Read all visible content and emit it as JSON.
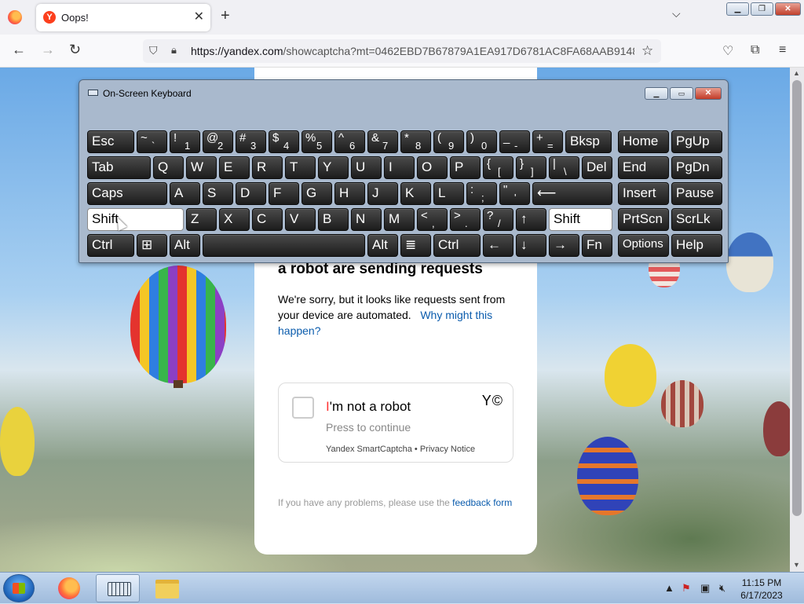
{
  "browser": {
    "tab_title": "Oops!",
    "tab_favicon": "Y",
    "new_tab": "+",
    "url_domain": "https://yandex.com",
    "url_rest": "/showcaptcha?mt=0462EBD7B67879A1EA917D6781AC8FA68AAB9148"
  },
  "page": {
    "heading": "a robot are sending requests",
    "body_text": "We're sorry, but it looks like requests sent from your device are automated.",
    "body_link": "Why might this happen?",
    "captcha": {
      "title_first": "I",
      "title_rest": "'m not a robot",
      "press": "Press to continue",
      "brand": "Y©",
      "footer": "Yandex SmartCaptcha • Privacy Notice"
    },
    "note_text": "If you have any problems, please use the",
    "note_link": "feedback form"
  },
  "osk": {
    "title": "On-Screen Keyboard",
    "rows": [
      [
        {
          "label": "Esc"
        },
        {
          "top": "~",
          "bottom": "`"
        },
        {
          "top": "!",
          "bottom": "1"
        },
        {
          "top": "@",
          "bottom": "2"
        },
        {
          "top": "#",
          "bottom": "3"
        },
        {
          "top": "$",
          "bottom": "4"
        },
        {
          "top": "%",
          "bottom": "5"
        },
        {
          "top": "^",
          "bottom": "6"
        },
        {
          "top": "&",
          "bottom": "7"
        },
        {
          "top": "*",
          "bottom": "8"
        },
        {
          "top": "(",
          "bottom": "9"
        },
        {
          "top": ")",
          "bottom": "0"
        },
        {
          "top": "_",
          "bottom": "-"
        },
        {
          "top": "+",
          "bottom": "="
        },
        {
          "label": "Bksp"
        },
        {
          "label": "Home"
        },
        {
          "label": "PgUp"
        }
      ],
      [
        {
          "label": "Tab"
        },
        {
          "label": "Q"
        },
        {
          "label": "W"
        },
        {
          "label": "E"
        },
        {
          "label": "R"
        },
        {
          "label": "T"
        },
        {
          "label": "Y"
        },
        {
          "label": "U"
        },
        {
          "label": "I"
        },
        {
          "label": "O"
        },
        {
          "label": "P"
        },
        {
          "top": "{",
          "bottom": "["
        },
        {
          "top": "}",
          "bottom": "]"
        },
        {
          "top": "|",
          "bottom": "\\"
        },
        {
          "label": "Del"
        },
        {
          "label": "End"
        },
        {
          "label": "PgDn"
        }
      ],
      [
        {
          "label": "Caps"
        },
        {
          "label": "A"
        },
        {
          "label": "S"
        },
        {
          "label": "D"
        },
        {
          "label": "F"
        },
        {
          "label": "G"
        },
        {
          "label": "H"
        },
        {
          "label": "J"
        },
        {
          "label": "K"
        },
        {
          "label": "L"
        },
        {
          "top": ":",
          "bottom": ";"
        },
        {
          "top": "\"",
          "bottom": "'"
        },
        {
          "label": "⟵"
        },
        {
          "label": "Insert"
        },
        {
          "label": "Pause"
        }
      ],
      [
        {
          "label": "Shift",
          "state": "pressed"
        },
        {
          "label": "Z"
        },
        {
          "label": "X"
        },
        {
          "label": "C"
        },
        {
          "label": "V"
        },
        {
          "label": "B"
        },
        {
          "label": "N"
        },
        {
          "label": "M"
        },
        {
          "top": "<",
          "bottom": ","
        },
        {
          "top": ">",
          "bottom": "."
        },
        {
          "top": "?",
          "bottom": "/"
        },
        {
          "label": "↑"
        },
        {
          "label": "Shift",
          "state": "pressed"
        },
        {
          "label": "PrtScn"
        },
        {
          "label": "ScrLk"
        }
      ],
      [
        {
          "label": "Ctrl"
        },
        {
          "label": "⊞"
        },
        {
          "label": "Alt"
        },
        {
          "label": ""
        },
        {
          "label": "Alt"
        },
        {
          "label": "≣"
        },
        {
          "label": "Ctrl"
        },
        {
          "label": "←"
        },
        {
          "label": "↓"
        },
        {
          "label": "→"
        },
        {
          "label": "Fn"
        },
        {
          "label": "Options"
        },
        {
          "label": "Help"
        }
      ]
    ]
  },
  "taskbar": {
    "time": "11:15 PM",
    "date": "6/17/2023"
  }
}
